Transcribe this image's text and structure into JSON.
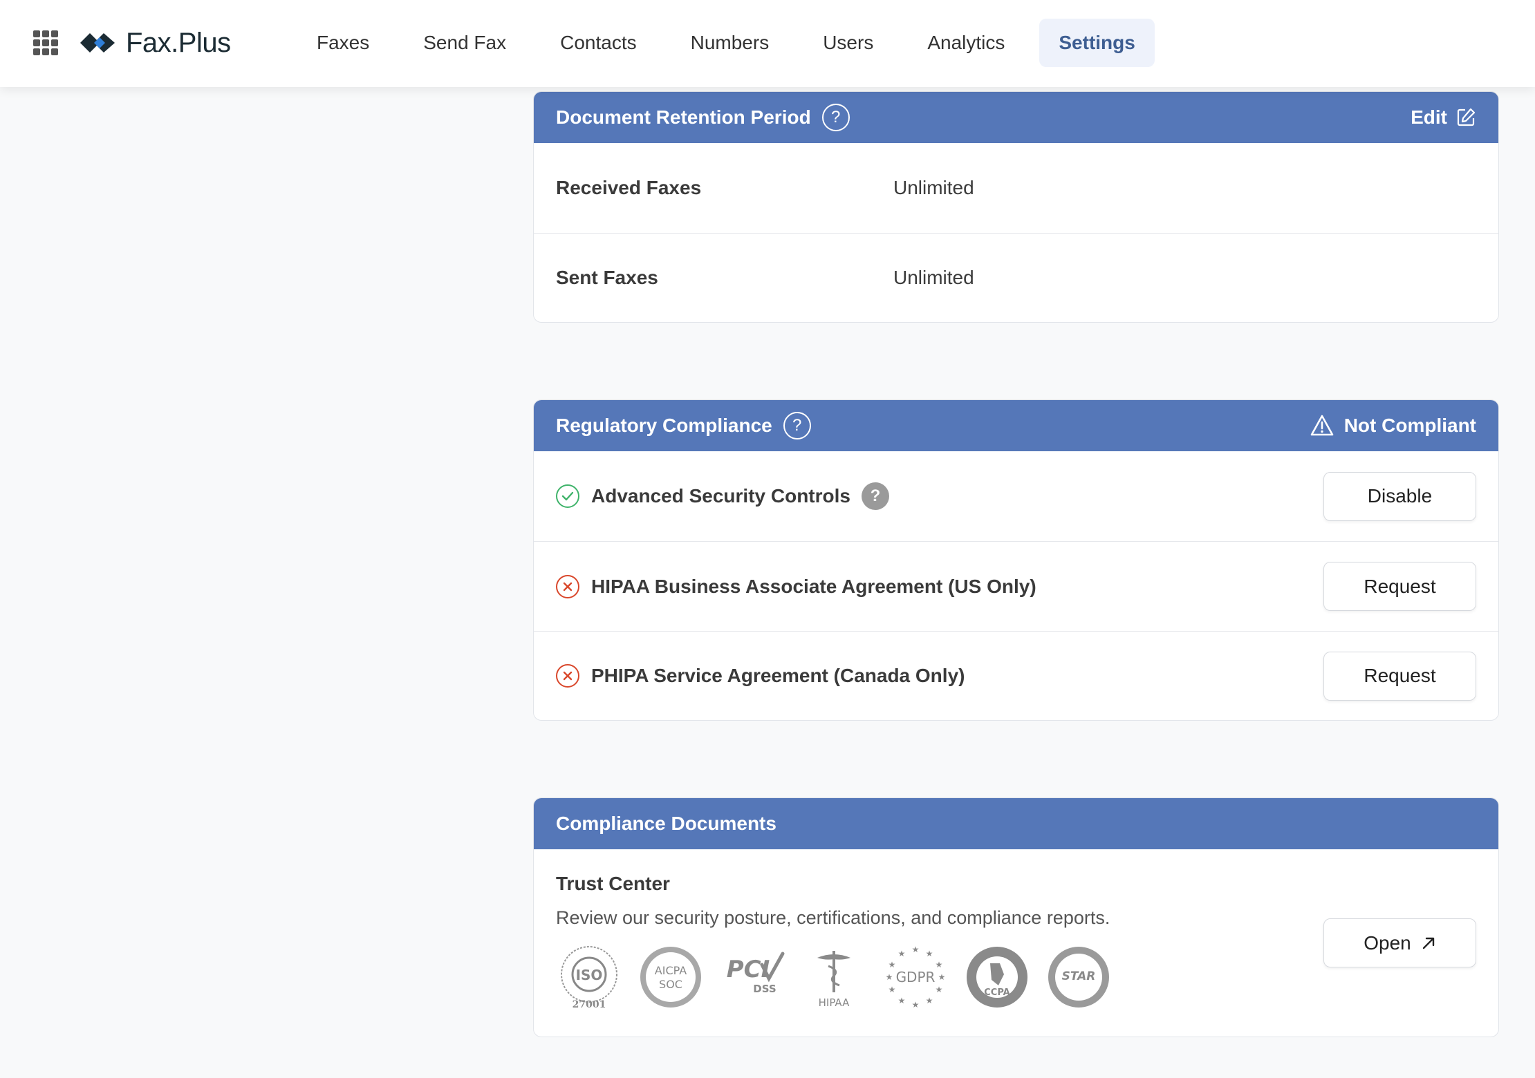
{
  "app": {
    "name": "Fax.Plus"
  },
  "nav": {
    "items": [
      {
        "label": "Faxes"
      },
      {
        "label": "Send Fax"
      },
      {
        "label": "Contacts"
      },
      {
        "label": "Numbers"
      },
      {
        "label": "Users"
      },
      {
        "label": "Analytics"
      },
      {
        "label": "Settings",
        "active": true
      }
    ]
  },
  "retention": {
    "title": "Document Retention Period",
    "help_icon": "help-circle-icon",
    "edit_label": "Edit",
    "edit_icon": "edit-icon",
    "rows": [
      {
        "label": "Received Faxes",
        "value": "Unlimited"
      },
      {
        "label": "Sent Faxes",
        "value": "Unlimited"
      }
    ]
  },
  "compliance": {
    "title": "Regulatory Compliance",
    "status": "Not Compliant",
    "status_icon": "warning-icon",
    "items": [
      {
        "label": "Advanced Security Controls",
        "state": "enabled",
        "action": "Disable",
        "has_help": true
      },
      {
        "label": "HIPAA Business Associate Agreement (US Only)",
        "state": "disabled",
        "action": "Request"
      },
      {
        "label": "PHIPA Service Agreement (Canada Only)",
        "state": "disabled",
        "action": "Request"
      }
    ]
  },
  "documents": {
    "title": "Compliance Documents",
    "trust_center": {
      "title": "Trust Center",
      "description": "Review our security posture, certifications, and compliance reports.",
      "action": "Open"
    },
    "badges": [
      {
        "name": "ISO 27001",
        "lines": [
          "ISO",
          "27001"
        ]
      },
      {
        "name": "AICPA SOC",
        "lines": [
          "AICPA",
          "SOC"
        ]
      },
      {
        "name": "PCI DSS",
        "lines": [
          "PCI",
          "DSS"
        ]
      },
      {
        "name": "HIPAA",
        "lines": [
          "HIPAA"
        ]
      },
      {
        "name": "GDPR",
        "lines": [
          "GDPR"
        ]
      },
      {
        "name": "CCPA",
        "lines": [
          "CCPA"
        ]
      },
      {
        "name": "STAR",
        "lines": [
          "STAR"
        ]
      }
    ]
  },
  "colors": {
    "header_bg": "#5577b8",
    "nav_active_bg": "#eef2fb",
    "nav_active_text": "#3e5e92",
    "ok": "#3fb36a",
    "bad": "#d9472b"
  }
}
